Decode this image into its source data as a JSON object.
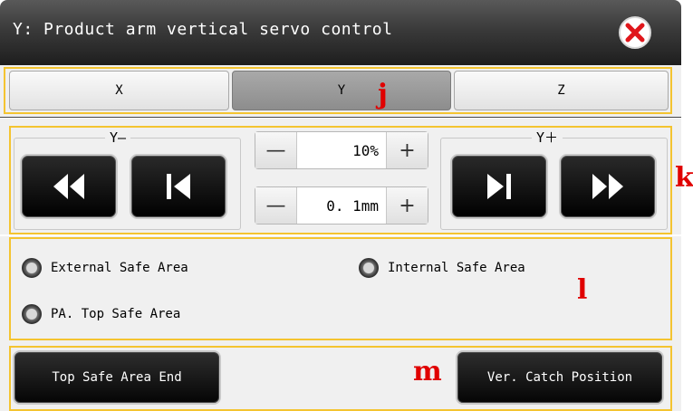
{
  "window": {
    "title": "Y: Product arm vertical servo control"
  },
  "tabs": [
    {
      "label": "X",
      "active": false
    },
    {
      "label": "Y",
      "active": true
    },
    {
      "label": "Z",
      "active": false
    }
  ],
  "jog": {
    "minus_label": "Y—",
    "plus_label": "Y＋",
    "buttons": [
      "fast-reverse-icon",
      "step-reverse-icon",
      "step-forward-icon",
      "fast-forward-icon"
    ]
  },
  "speed_stepper": {
    "minus": "—",
    "value": "10%",
    "plus": "+"
  },
  "distance_stepper": {
    "minus": "—",
    "value": "0. 1mm",
    "plus": "+"
  },
  "safe_areas": [
    {
      "label": "External Safe Area",
      "selected": false
    },
    {
      "label": "Internal Safe Area",
      "selected": false
    },
    {
      "label": "PA. Top Safe Area",
      "selected": false
    }
  ],
  "actions": {
    "top_safe_area_end": "Top Safe Area End",
    "ver_catch_position": "Ver. Catch Position"
  },
  "annotations": {
    "tabs": "j",
    "jog": "k",
    "safe": "l",
    "actions": "m"
  },
  "colors": {
    "highlight_box": "#f4c430",
    "annotation": "#e00000",
    "close_icon": "#e0161b"
  }
}
